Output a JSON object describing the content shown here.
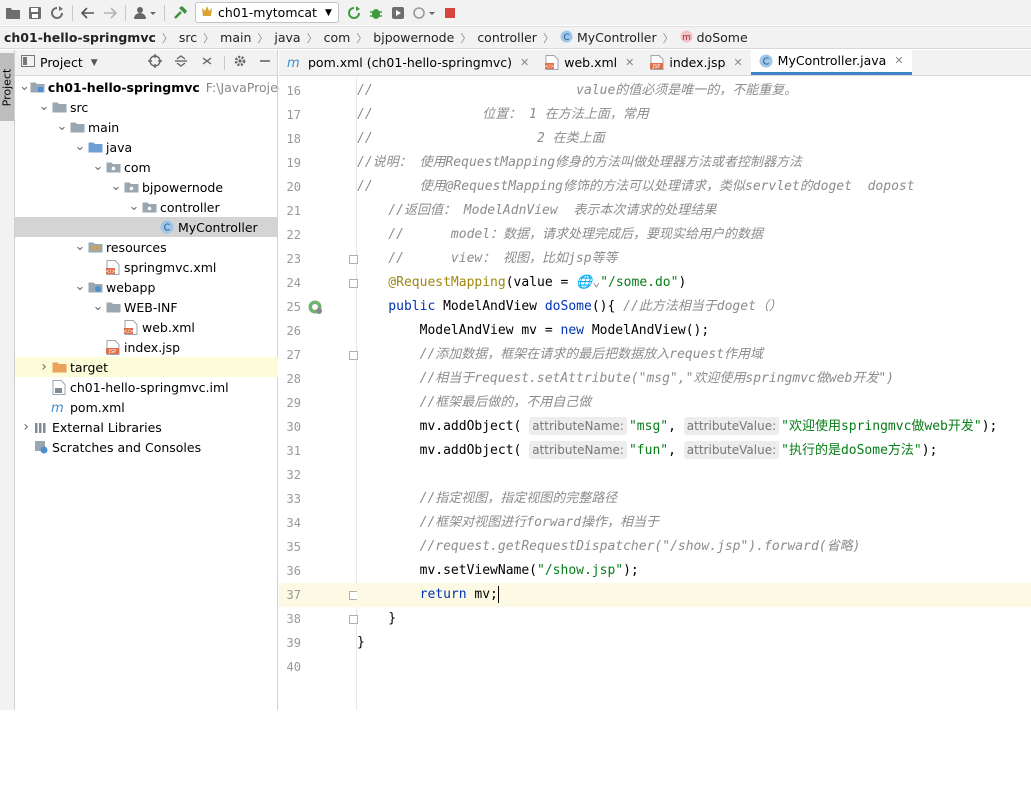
{
  "toolbar": {
    "run_config": "ch01-mytomcat"
  },
  "breadcrumb": [
    "ch01-hello-springmvc",
    "src",
    "main",
    "java",
    "com",
    "bjpowernode",
    "controller",
    "MyController",
    "doSome"
  ],
  "sidebar": {
    "tab_label": "Project"
  },
  "project_panel": {
    "title": "Project",
    "tree": [
      {
        "label": "ch01-hello-springmvc",
        "extra": "F:\\JavaProject\\",
        "depth": 0,
        "icon": "folder-module-icon",
        "expanded": true,
        "bold": true
      },
      {
        "label": "src",
        "depth": 1,
        "icon": "folder-icon",
        "expanded": true
      },
      {
        "label": "main",
        "depth": 2,
        "icon": "folder-icon",
        "expanded": true
      },
      {
        "label": "java",
        "depth": 3,
        "icon": "source-folder-icon",
        "expanded": true
      },
      {
        "label": "com",
        "depth": 4,
        "icon": "package-icon",
        "expanded": true
      },
      {
        "label": "bjpowernode",
        "depth": 5,
        "icon": "package-icon",
        "expanded": true
      },
      {
        "label": "controller",
        "depth": 6,
        "icon": "package-icon",
        "expanded": true
      },
      {
        "label": "MyController",
        "depth": 7,
        "icon": "class-icon",
        "selected": true
      },
      {
        "label": "resources",
        "depth": 3,
        "icon": "resources-folder-icon",
        "expanded": true
      },
      {
        "label": "springmvc.xml",
        "depth": 4,
        "icon": "xml-file-icon"
      },
      {
        "label": "webapp",
        "depth": 3,
        "icon": "web-folder-icon",
        "expanded": true
      },
      {
        "label": "WEB-INF",
        "depth": 4,
        "icon": "folder-icon",
        "expanded": true
      },
      {
        "label": "web.xml",
        "depth": 5,
        "icon": "xml-file-icon"
      },
      {
        "label": "index.jsp",
        "depth": 4,
        "icon": "jsp-file-icon"
      },
      {
        "label": "target",
        "depth": 1,
        "icon": "excluded-folder-icon",
        "expanded": false,
        "target": true
      },
      {
        "label": "ch01-hello-springmvc.iml",
        "depth": 1,
        "icon": "iml-file-icon"
      },
      {
        "label": "pom.xml",
        "depth": 1,
        "icon": "maven-file-icon"
      },
      {
        "label": "External Libraries",
        "depth": 0,
        "icon": "libraries-icon",
        "expanded": false
      },
      {
        "label": "Scratches and Consoles",
        "depth": 0,
        "icon": "scratches-icon"
      }
    ]
  },
  "editor": {
    "tabs": [
      {
        "label": "pom.xml (ch01-hello-springmvc)",
        "icon": "maven-file-icon"
      },
      {
        "label": "web.xml",
        "icon": "xml-file-icon"
      },
      {
        "label": "index.jsp",
        "icon": "jsp-file-icon"
      },
      {
        "label": "MyController.java",
        "icon": "class-icon",
        "active": true
      }
    ],
    "lines": [
      {
        "n": "16",
        "parts": [
          [
            "c",
            "//                          value的值必须是唯一的，不能重复。"
          ]
        ]
      },
      {
        "n": "17",
        "parts": [
          [
            "c",
            "//              位置： 1 在方法上面，常用"
          ]
        ]
      },
      {
        "n": "18",
        "parts": [
          [
            "c",
            "//                     2 在类上面"
          ]
        ]
      },
      {
        "n": "19",
        "parts": [
          [
            "c",
            "//说明： 使用RequestMapping修身的方法叫做处理器方法或者控制器方法"
          ]
        ]
      },
      {
        "n": "20",
        "parts": [
          [
            "c",
            "//      使用@RequestMapping修饰的方法可以处理请求，类似servlet的doget  dopost"
          ]
        ]
      },
      {
        "n": "21",
        "parts": [
          [
            "c",
            "    //返回值： ModelAdnView  表示本次请求的处理结果"
          ]
        ]
      },
      {
        "n": "22",
        "parts": [
          [
            "c",
            "    //      model：数据，请求处理完成后，要现实给用户的数据"
          ]
        ]
      },
      {
        "n": "23",
        "parts": [
          [
            "c",
            "    //      view： 视图，比如jsp等等"
          ]
        ]
      },
      {
        "n": "24",
        "parts": [
          [
            "an",
            "    @RequestMapping"
          ],
          [
            "",
            "(value = "
          ],
          [
            "c",
            "🌐⌄"
          ],
          [
            "st",
            "\"/some.do\""
          ],
          [
            "",
            ")"
          ]
        ]
      },
      {
        "n": "25",
        "parts": [
          [
            "kw",
            "    public "
          ],
          [
            "",
            "ModelAndView "
          ],
          [
            "kw",
            "doSome"
          ],
          [
            "",
            "(){ "
          ],
          [
            "c",
            "//此方法相当于doget（）"
          ]
        ]
      },
      {
        "n": "26",
        "parts": [
          [
            "",
            "        ModelAndView mv = "
          ],
          [
            "kw",
            "new "
          ],
          [
            "",
            "ModelAndView();"
          ]
        ]
      },
      {
        "n": "27",
        "parts": [
          [
            "c",
            "        //添加数据，框架在请求的最后把数据放入request作用域"
          ]
        ]
      },
      {
        "n": "28",
        "parts": [
          [
            "c",
            "        //相当于request.setAttribute(\"msg\",\"欢迎使用springmvc做web开发\")"
          ]
        ]
      },
      {
        "n": "29",
        "parts": [
          [
            "c",
            "        //框架最后做的，不用自己做"
          ]
        ]
      },
      {
        "n": "30",
        "parts": [
          [
            "",
            "        mv.addObject( "
          ],
          [
            "hint",
            "attributeName:"
          ],
          [
            "st",
            "\"msg\""
          ],
          [
            "",
            ", "
          ],
          [
            "hint",
            "attributeValue:"
          ],
          [
            "st",
            "\"欢迎使用springmvc做web开发\""
          ],
          [
            "",
            ");"
          ]
        ]
      },
      {
        "n": "31",
        "parts": [
          [
            "",
            "        mv.addObject( "
          ],
          [
            "hint",
            "attributeName:"
          ],
          [
            "st",
            "\"fun\""
          ],
          [
            "",
            ", "
          ],
          [
            "hint",
            "attributeValue:"
          ],
          [
            "st",
            "\"执行的是doSome方法\""
          ],
          [
            "",
            ");"
          ]
        ]
      },
      {
        "n": "32",
        "parts": []
      },
      {
        "n": "33",
        "parts": [
          [
            "c",
            "        //指定视图，指定视图的完整路径"
          ]
        ]
      },
      {
        "n": "34",
        "parts": [
          [
            "c",
            "        //框架对视图进行forward操作，相当于"
          ]
        ]
      },
      {
        "n": "35",
        "parts": [
          [
            "c",
            "        //request.getRequestDispatcher(\"/show.jsp\").forward(省略)"
          ]
        ]
      },
      {
        "n": "36",
        "parts": [
          [
            "",
            "        mv.setViewName("
          ],
          [
            "st",
            "\"/show.jsp\""
          ],
          [
            "",
            ");"
          ]
        ]
      },
      {
        "n": "37",
        "parts": [
          [
            "kw",
            "        return "
          ],
          [
            "",
            "mv;"
          ],
          [
            "caret",
            ""
          ]
        ],
        "current": true
      },
      {
        "n": "38",
        "parts": [
          [
            "",
            "    }"
          ]
        ]
      },
      {
        "n": "39",
        "parts": [
          [
            "",
            "}"
          ]
        ]
      },
      {
        "n": "40",
        "parts": []
      }
    ]
  }
}
